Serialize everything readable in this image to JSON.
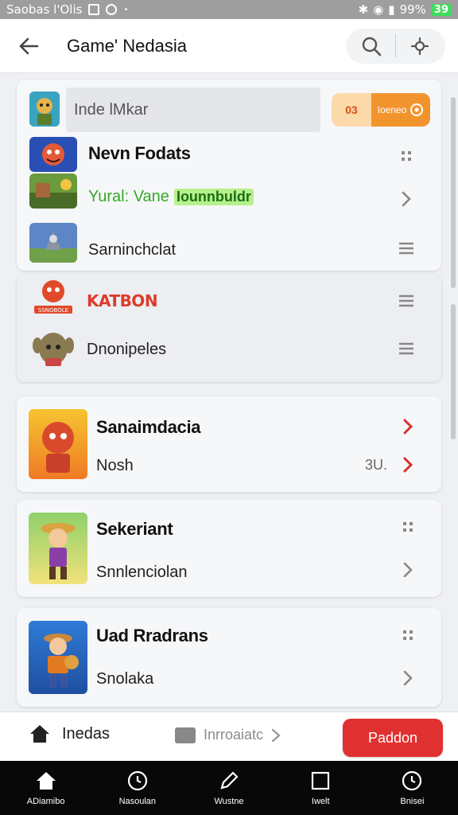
{
  "status_bar": {
    "left_text": "Saobas l'Olis",
    "battery_pct": "99%",
    "battery_level": "39"
  },
  "app_bar": {
    "title": "Game' Nedasia"
  },
  "top_card": {
    "search_placeholder": "Inde lMkar",
    "orange_btn_left": "03",
    "orange_btn_right": "Ioeneo",
    "rows": [
      {
        "title": "Nevn Fodats"
      },
      {
        "subtitle": "Yural: Vane",
        "tag": "Iounnbuldr"
      },
      {
        "subtitle": "Sarninchclat"
      }
    ]
  },
  "second_card": {
    "rows": [
      {
        "logo_text": "KATBON",
        "logo_caption": "SSNOBOLE"
      },
      {
        "subtitle": "Dnonipeles"
      }
    ]
  },
  "game_cards": [
    {
      "title": "Sanaimdacia",
      "subtitle": "Nosh",
      "meta": "3U."
    },
    {
      "title": "Sekeriant",
      "subtitle": "Snnlenciolan"
    },
    {
      "title": "Uad Rradrans",
      "subtitle": "Snolaka"
    }
  ],
  "bottom_actions": {
    "home_label": "Inedas",
    "mid_label": "Inrroaiatc",
    "primary_label": "Paddon"
  },
  "nav": [
    {
      "label": "ADiamibo",
      "icon": "home-icon"
    },
    {
      "label": "Nasoulan",
      "icon": "clock-icon"
    },
    {
      "label": "Wustne",
      "icon": "pencil-icon"
    },
    {
      "label": "Iwelt",
      "icon": "square-icon"
    },
    {
      "label": "Bnisei",
      "icon": "clock-icon"
    }
  ],
  "colors": {
    "accent_red": "#e13030",
    "accent_orange": "#f2942e",
    "accent_green": "#34a827",
    "navbar": "#080808"
  }
}
